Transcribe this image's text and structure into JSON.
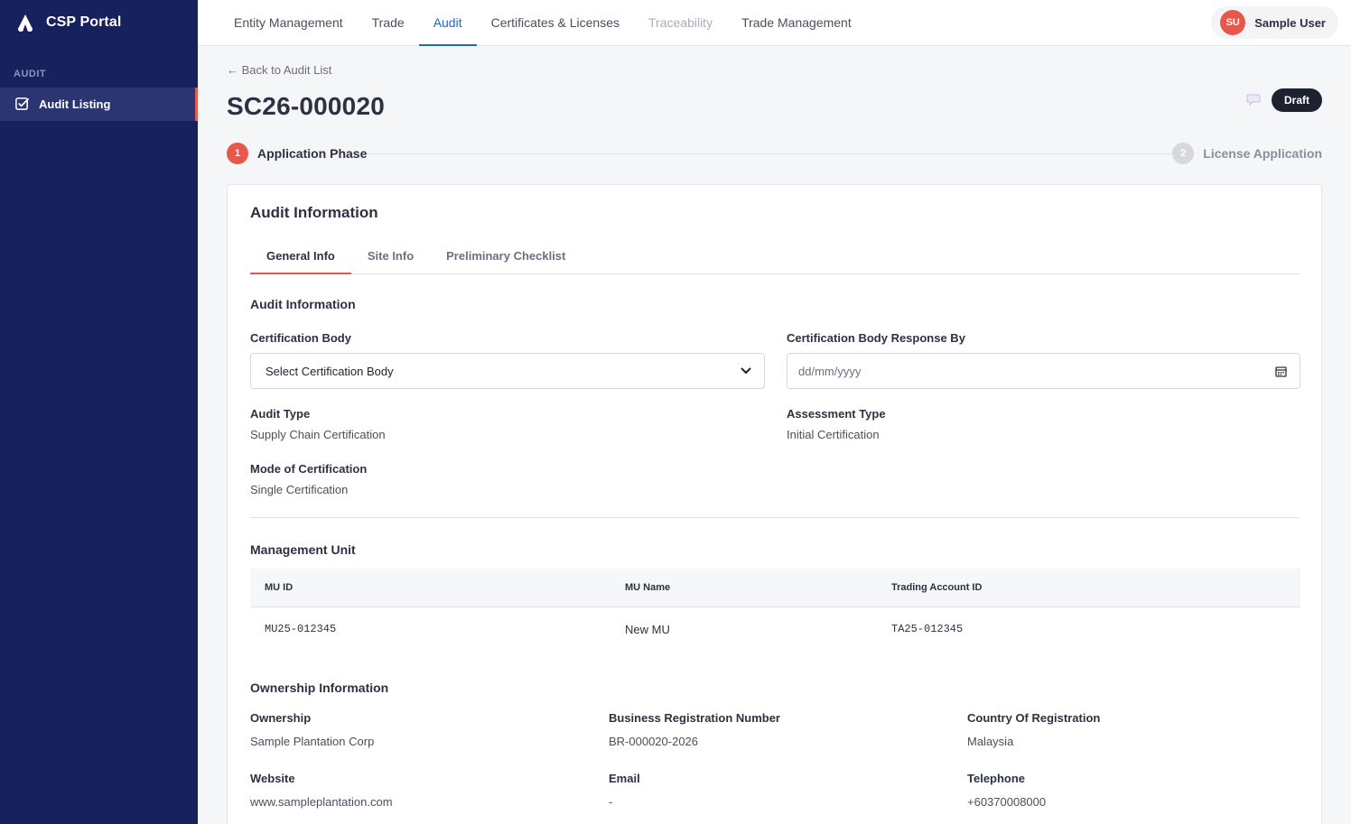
{
  "app": {
    "name": "CSP Portal"
  },
  "sidebar": {
    "section": "AUDIT",
    "items": [
      {
        "label": "Audit Listing",
        "icon": "checkbox-icon",
        "active": true
      }
    ]
  },
  "topnav": {
    "tabs": [
      {
        "label": "Entity Management",
        "state": "normal"
      },
      {
        "label": "Trade",
        "state": "normal"
      },
      {
        "label": "Audit",
        "state": "active"
      },
      {
        "label": "Certificates & Licenses",
        "state": "normal"
      },
      {
        "label": "Traceability",
        "state": "disabled"
      },
      {
        "label": "Trade Management",
        "state": "normal"
      }
    ],
    "user": {
      "initials": "SU",
      "name": "Sample User"
    }
  },
  "page": {
    "back_link": "← Back to Audit List",
    "title": "SC26-000020",
    "status": "Draft"
  },
  "stepper": {
    "steps": [
      {
        "num": "1",
        "label": "Application Phase",
        "active": true
      },
      {
        "num": "2",
        "label": "License Application",
        "active": false
      }
    ]
  },
  "card": {
    "title": "Audit Information",
    "tabs": [
      "General Info",
      "Site Info",
      "Preliminary Checklist"
    ],
    "active_tab": "General Info",
    "audit_info": {
      "heading": "Audit Information",
      "certification_body_label": "Certification Body",
      "certification_body_value": "Select Certification Body",
      "response_by_label": "Certification Body Response By",
      "response_by_placeholder": "dd/mm/yyyy",
      "audit_type_label": "Audit Type",
      "audit_type_value": "Supply Chain Certification",
      "assessment_type_label": "Assessment Type",
      "assessment_type_value": "Initial Certification",
      "mode_label": "Mode of Certification",
      "mode_value": "Single Certification"
    },
    "management_unit": {
      "heading": "Management Unit",
      "columns": [
        "MU ID",
        "MU Name",
        "Trading Account ID"
      ],
      "rows": [
        [
          "MU25-012345",
          "New MU",
          "TA25-012345"
        ]
      ]
    },
    "ownership": {
      "heading": "Ownership Information",
      "ownership_label": "Ownership",
      "ownership_value": "Sample Plantation Corp",
      "brn_label": "Business Registration Number",
      "brn_value": "BR-000020-2026",
      "country_label": "Country Of Registration",
      "country_value": "Malaysia",
      "website_label": "Website",
      "website_value": "www.sampleplantation.com",
      "email_label": "Email",
      "email_value": "-",
      "telephone_label": "Telephone",
      "telephone_value": "+60370008000"
    }
  },
  "colors": {
    "sidebar": "#16215e",
    "accent": "#e8574b",
    "active_tab": "#2563d0"
  }
}
